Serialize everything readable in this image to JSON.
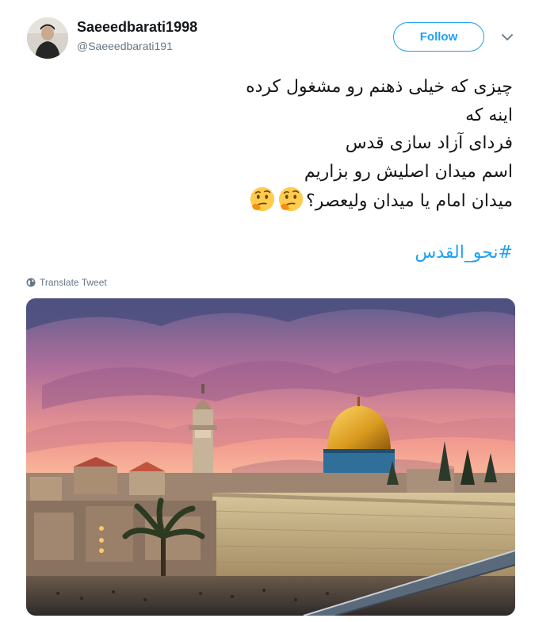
{
  "author": {
    "display_name": "Saeeedbarati1998",
    "handle": "@Saeeedbarati191"
  },
  "actions": {
    "follow_label": "Follow"
  },
  "tweet": {
    "lines": [
      "چیزی که خیلی ذهنم رو مشغول کرده",
      "اینه که",
      "فردای آزاد سازی قدس",
      "اسم میدان اصلیش رو بزاریم",
      "میدان امام یا میدان ولیعصر؟"
    ],
    "emoji": [
      "thinking-face",
      "thinking-face"
    ],
    "hashtag": "#نحو_القدس"
  },
  "translate_label": "Translate Tweet",
  "colors": {
    "accent": "#1da1f2",
    "secondary_text": "#657786",
    "primary_text": "#14171a"
  },
  "icons": {
    "chevron": "chevron-down-icon",
    "globe": "globe-icon"
  }
}
